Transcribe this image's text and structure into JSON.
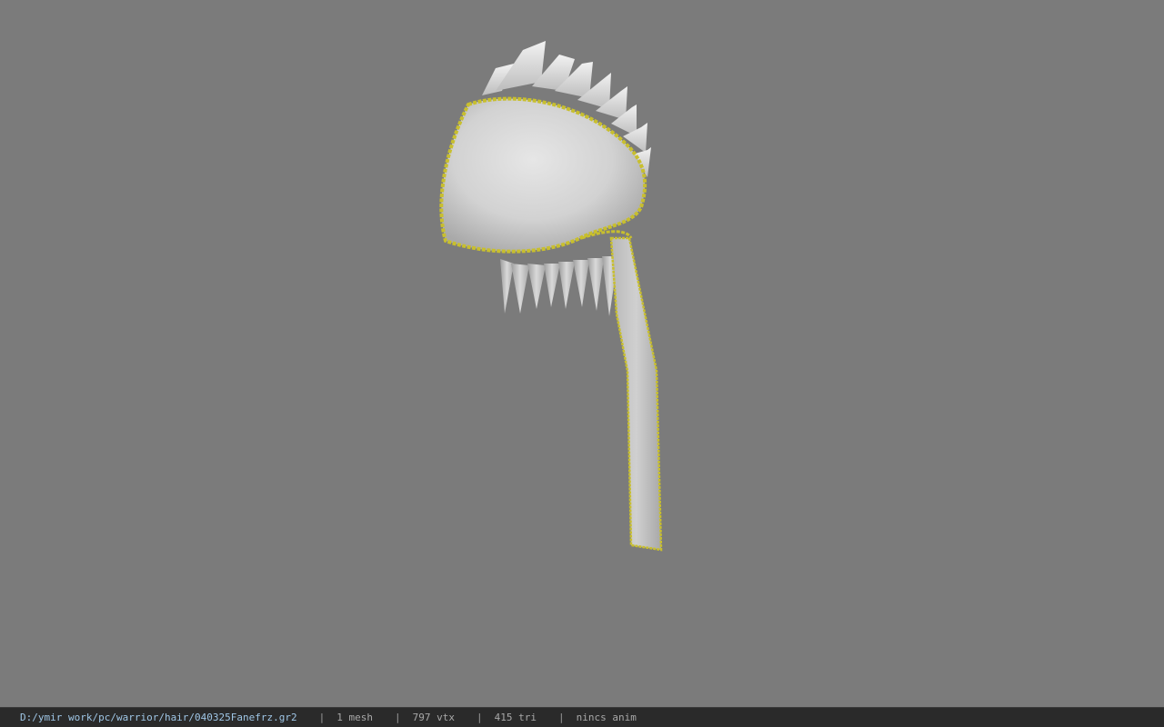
{
  "statusbar": {
    "file_path": "D:/ymir work/pc/warrior/hair/040325Fanefrz.gr2",
    "separator": "|",
    "mesh_count": "1 mesh",
    "vertex_count": "797 vtx",
    "triangle_count": "415 tri",
    "anim_status": "nincs anim"
  },
  "colors": {
    "viewport_background": "#7b7b7b",
    "statusbar_background": "#2a2a2a",
    "path_text": "#9fc6e6",
    "stat_text": "#a8a8a8",
    "mesh_surface": "#d8d8d8",
    "mesh_trim": "#c8bf2e"
  },
  "model": {
    "icon": "hair-mesh-model",
    "description_visible": false
  }
}
